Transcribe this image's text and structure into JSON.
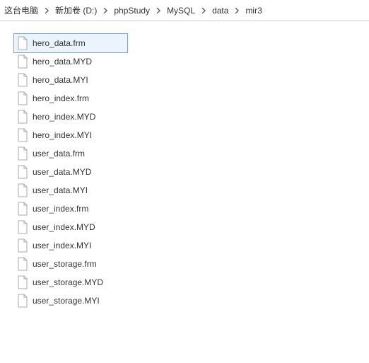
{
  "breadcrumb": {
    "items": [
      {
        "label": "这台电脑"
      },
      {
        "label": "新加卷 (D:)"
      },
      {
        "label": "phpStudy"
      },
      {
        "label": "MySQL"
      },
      {
        "label": "data"
      },
      {
        "label": "mir3"
      }
    ]
  },
  "files": {
    "selected_index": 0,
    "items": [
      {
        "name": "hero_data.frm"
      },
      {
        "name": "hero_data.MYD"
      },
      {
        "name": "hero_data.MYI"
      },
      {
        "name": "hero_index.frm"
      },
      {
        "name": "hero_index.MYD"
      },
      {
        "name": "hero_index.MYI"
      },
      {
        "name": "user_data.frm"
      },
      {
        "name": "user_data.MYD"
      },
      {
        "name": "user_data.MYI"
      },
      {
        "name": "user_index.frm"
      },
      {
        "name": "user_index.MYD"
      },
      {
        "name": "user_index.MYI"
      },
      {
        "name": "user_storage.frm"
      },
      {
        "name": "user_storage.MYD"
      },
      {
        "name": "user_storage.MYI"
      }
    ]
  }
}
